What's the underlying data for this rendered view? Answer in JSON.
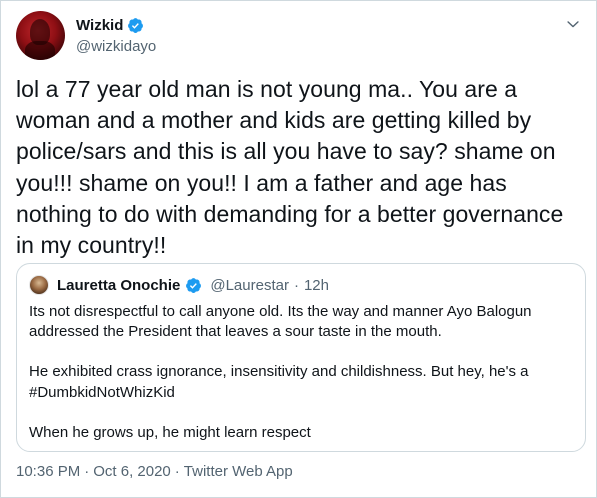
{
  "author": {
    "display_name": "Wizkid",
    "handle": "@wizkidayo",
    "verified_icon": "verified-badge-icon",
    "accent_color": "#1d9bf0"
  },
  "tweet": {
    "text": "lol a 77 year old man is not young ma.. You are a woman and a mother and kids are getting killed by police/sars and this is all you have to say? shame on you!!! shame on you!! I am a father and age has nothing to do with demanding for a better governance in my country!!"
  },
  "quote": {
    "display_name": "Lauretta Onochie",
    "handle": "@Laurestar",
    "separator": "·",
    "time": "12h",
    "para1": "Its not disrespectful to call anyone old. Its the way and manner Ayo Balogun addressed the President that leaves a sour taste in the mouth.",
    "para2": "He exhibited crass ignorance, insensitivity and childishness. But hey, he's a #DumbkidNotWhizKid",
    "para3": "When he grows up, he might learn respect"
  },
  "footer": {
    "time": "10:36 PM",
    "sep1": "·",
    "date": "Oct 6, 2020",
    "sep2": "·",
    "source": "Twitter Web App"
  }
}
